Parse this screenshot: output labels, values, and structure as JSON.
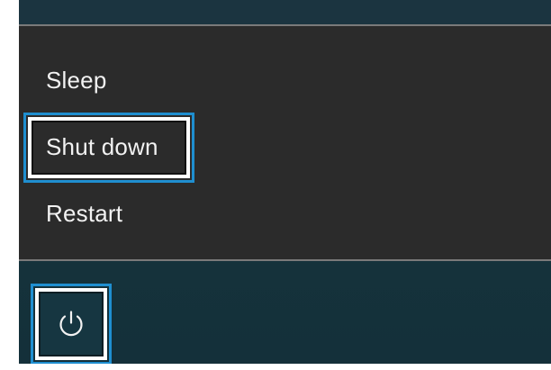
{
  "power_menu": {
    "items": [
      {
        "label": "Sleep"
      },
      {
        "label": "Shut down"
      },
      {
        "label": "Restart"
      }
    ],
    "highlighted_item": "Shut down"
  },
  "power_button": {
    "icon": "power-icon"
  },
  "colors": {
    "menu_background": "#2b2b2b",
    "start_background": "#18303a",
    "highlight_border": "#1f8fd0",
    "text": "#f2f2f2"
  }
}
